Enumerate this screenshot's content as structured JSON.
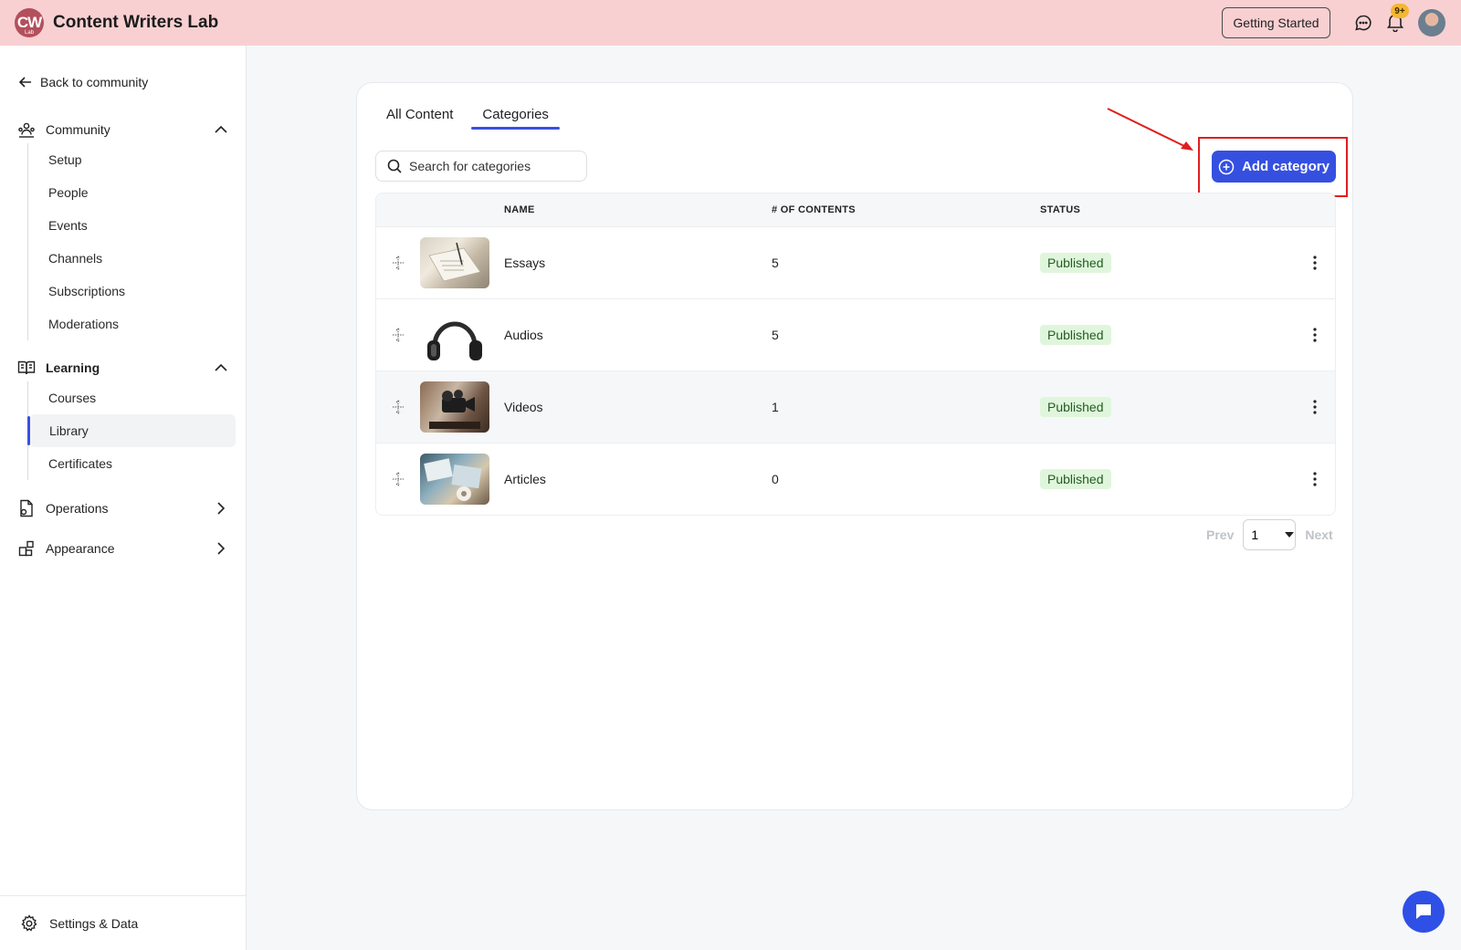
{
  "app": {
    "logo_text": "CW",
    "logo_sub": "Lab",
    "title": "Content Writers Lab"
  },
  "topbar": {
    "getting_started": "Getting Started",
    "notification_badge": "9+",
    "icons": [
      "chat-icon",
      "bell-icon",
      "avatar"
    ]
  },
  "sidebar": {
    "back_label": "Back to community",
    "community": {
      "label": "Community",
      "items": [
        "Setup",
        "People",
        "Events",
        "Channels",
        "Subscriptions",
        "Moderations"
      ]
    },
    "learning": {
      "label": "Learning",
      "items": [
        "Courses",
        "Library",
        "Certificates"
      ],
      "active": "Library"
    },
    "operations": {
      "label": "Operations"
    },
    "appearance": {
      "label": "Appearance"
    },
    "footer_label": "Settings & Data"
  },
  "main": {
    "tabs": [
      {
        "label": "All Content",
        "active": false
      },
      {
        "label": "Categories",
        "active": true
      }
    ],
    "search_placeholder": "Search for categories",
    "add_button": "Add category",
    "columns": [
      "NAME",
      "# OF CONTENTS",
      "STATUS"
    ],
    "rows": [
      {
        "name": "Essays",
        "count": "5",
        "status": "Published"
      },
      {
        "name": "Audios",
        "count": "5",
        "status": "Published"
      },
      {
        "name": "Videos",
        "count": "1",
        "status": "Published"
      },
      {
        "name": "Articles",
        "count": "0",
        "status": "Published"
      }
    ],
    "pager": {
      "prev": "Prev",
      "page": "1",
      "next": "Next"
    }
  },
  "colors": {
    "topbar_bg": "#f8d0d2",
    "accent": "#3550e0",
    "published_bg": "#e0f6dc",
    "highlight": "#e01e1e"
  }
}
